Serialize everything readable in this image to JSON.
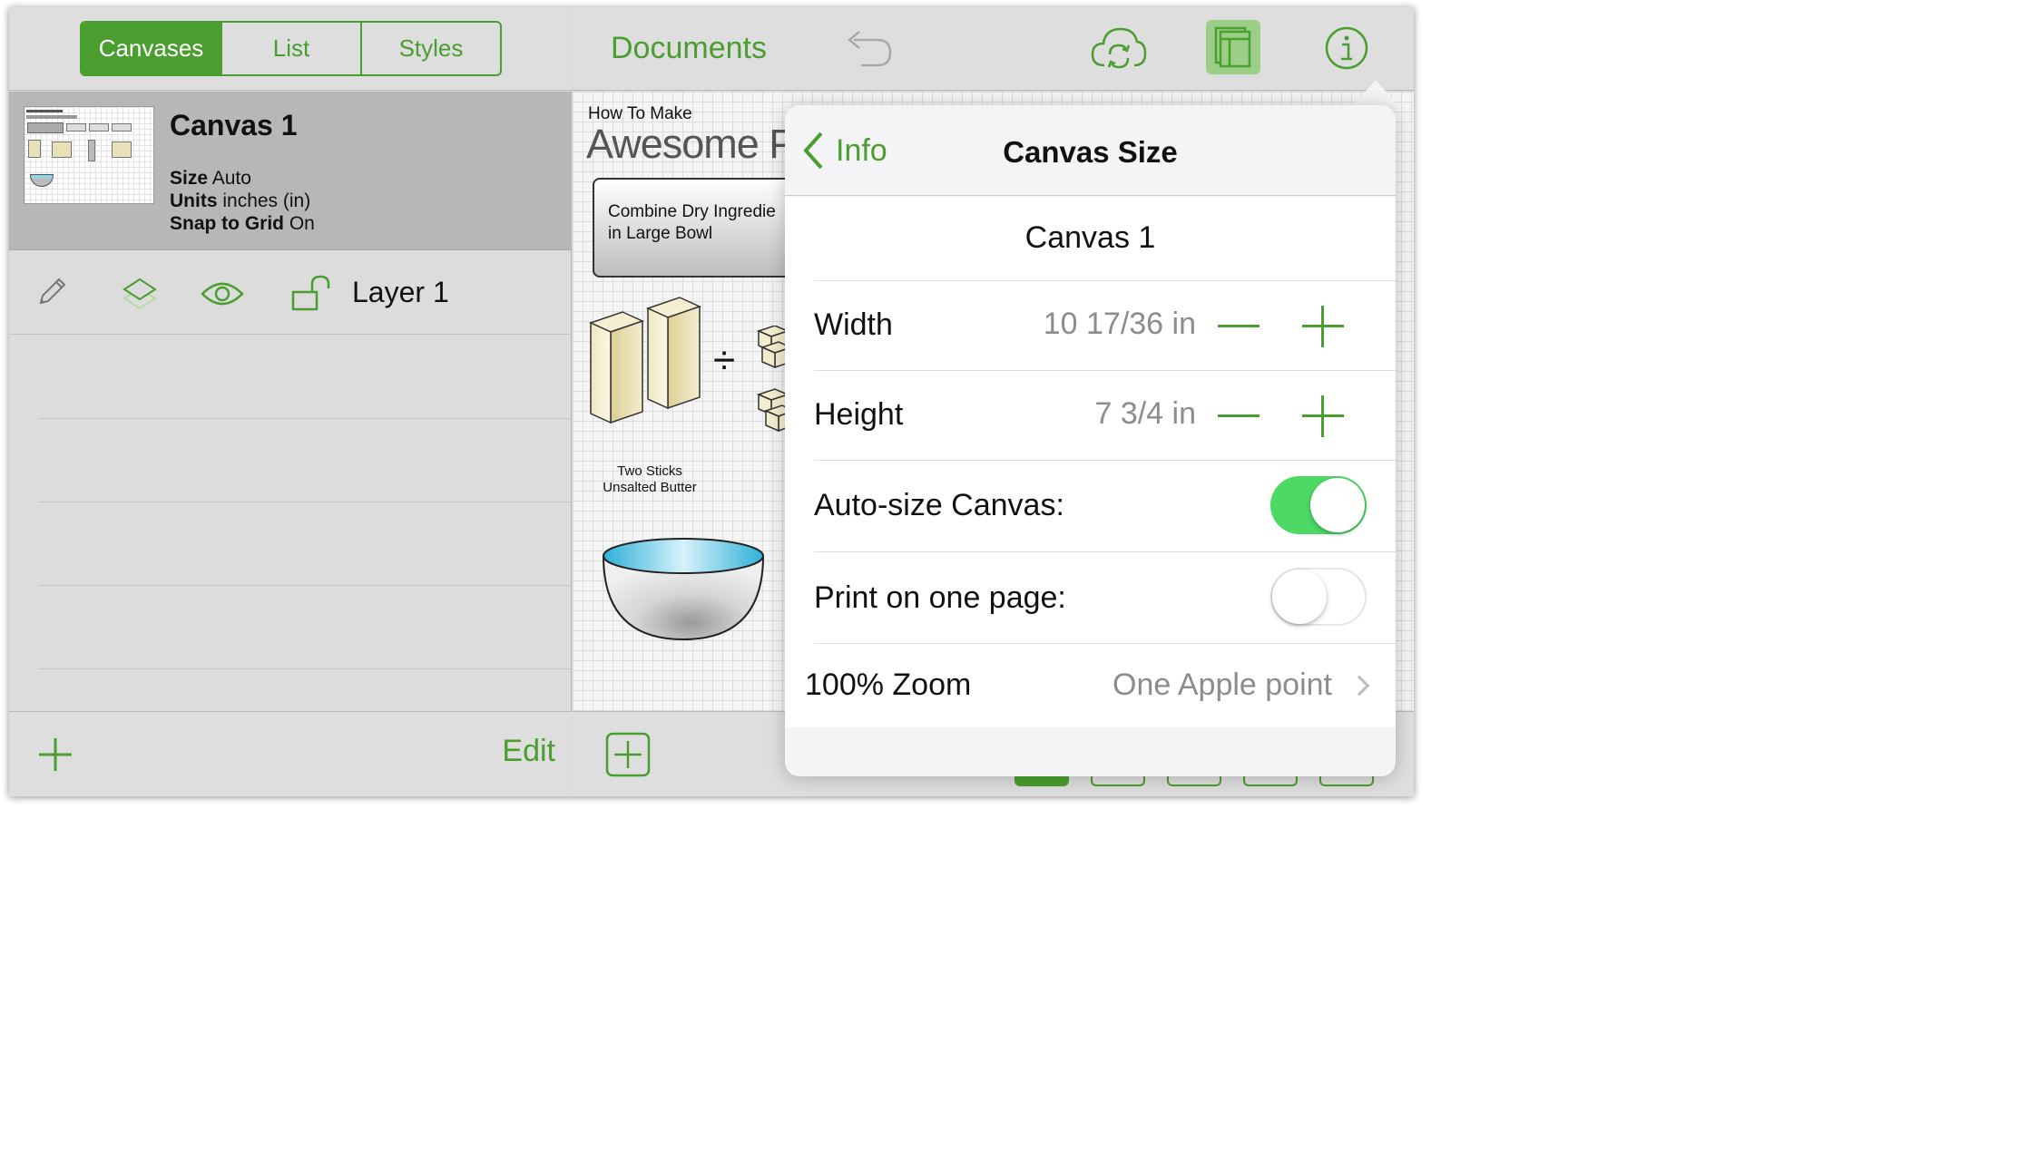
{
  "sidebar": {
    "segments": [
      {
        "label": "Canvases",
        "active": true
      },
      {
        "label": "List",
        "active": false
      },
      {
        "label": "Styles",
        "active": false
      }
    ],
    "canvas": {
      "name": "Canvas 1",
      "size_key": "Size",
      "size_value": "Auto",
      "units_key": "Units",
      "units_value": "inches (in)",
      "snap_key": "Snap to Grid",
      "snap_value": "On"
    },
    "layer": {
      "name": "Layer 1",
      "icons": [
        "pencil-icon",
        "layers-icon",
        "eye-icon",
        "unlock-icon"
      ]
    },
    "bottom": {
      "add_icon": "plus-icon",
      "edit_label": "Edit"
    }
  },
  "toolbar": {
    "documents_label": "Documents",
    "icons": [
      "undo-icon",
      "cloud-sync-icon",
      "canvases-panel-icon",
      "info-icon"
    ]
  },
  "document": {
    "small_title": "How To Make",
    "big_title": "Awesome P",
    "step_box_text": "Combine Dry Ingredie\nin Large Bowl",
    "divide_symbol": "÷",
    "butter_label": "Two Sticks\nUnsalted Butter"
  },
  "popover": {
    "back_label": "Info",
    "title": "Canvas Size",
    "canvas_name": "Canvas 1",
    "width_label": "Width",
    "width_value": "10 17/36 in",
    "height_label": "Height",
    "height_value": "7 3/4 in",
    "autosize_label": "Auto-size Canvas:",
    "autosize_on": true,
    "print_label": "Print on one page:",
    "print_on": false,
    "zoom_label": "100% Zoom",
    "zoom_value": "One Apple point"
  },
  "colors": {
    "accent": "#4a9e2f",
    "toggle_on": "#4cd964",
    "bowl_liquid": "#5cc9e8"
  }
}
